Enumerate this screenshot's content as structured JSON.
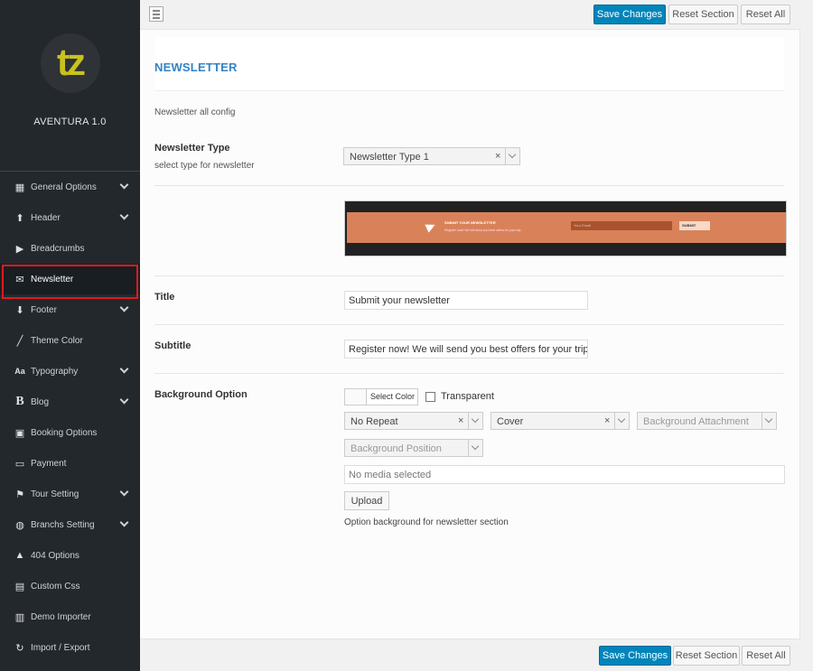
{
  "sidebar": {
    "brand_name": "AVENTURA 1.0",
    "logo_text": "tz",
    "items": [
      {
        "label": "General Options",
        "icon": "grid-icon",
        "has_children": true
      },
      {
        "label": "Header",
        "icon": "arrow-up-icon",
        "has_children": true
      },
      {
        "label": "Breadcrumbs",
        "icon": "play-icon",
        "has_children": false
      },
      {
        "label": "Newsletter",
        "icon": "envelope-icon",
        "has_children": false,
        "active": true
      },
      {
        "label": "Footer",
        "icon": "arrow-down-icon",
        "has_children": true
      },
      {
        "label": "Theme Color",
        "icon": "brush-icon",
        "has_children": false
      },
      {
        "label": "Typography",
        "icon": "font-icon",
        "has_children": true
      },
      {
        "label": "Blog",
        "icon": "bold-b-icon",
        "has_children": true
      },
      {
        "label": "Booking Options",
        "icon": "book-icon",
        "has_children": false
      },
      {
        "label": "Payment",
        "icon": "credit-card-icon",
        "has_children": false
      },
      {
        "label": "Tour Setting",
        "icon": "flag-icon",
        "has_children": true
      },
      {
        "label": "Branchs Setting",
        "icon": "globe-icon",
        "has_children": true
      },
      {
        "label": "404 Options",
        "icon": "warning-icon",
        "has_children": false
      },
      {
        "label": "Custom Css",
        "icon": "code-icon",
        "has_children": false
      },
      {
        "label": "Demo Importer",
        "icon": "monitor-icon",
        "has_children": false
      },
      {
        "label": "Import / Export",
        "icon": "refresh-icon",
        "has_children": false
      }
    ]
  },
  "toolbar": {
    "save_label": "Save Changes",
    "reset_section_label": "Reset Section",
    "reset_all_label": "Reset All"
  },
  "section": {
    "title": "NEWSLETTER",
    "description": "Newsletter all config"
  },
  "fields": {
    "newsletter_type": {
      "label": "Newsletter Type",
      "sublabel": "select type for newsletter",
      "value": "Newsletter Type 1"
    },
    "preview": {
      "heading": "SUBMIT YOUR NEWSLETTER",
      "subtext": "Register now! We will send you best offers for your trip.",
      "input_placeholder": "Your Email",
      "button_label": "SUBMIT"
    },
    "title": {
      "label": "Title",
      "value": "Submit your newsletter"
    },
    "subtitle": {
      "label": "Subtitle",
      "value": "Register now! We will send you best offers for your trip."
    },
    "background": {
      "label": "Background Option",
      "select_color_label": "Select Color",
      "transparent_label": "Transparent",
      "repeat_value": "No Repeat",
      "size_value": "Cover",
      "attachment_placeholder": "Background Attachment",
      "position_placeholder": "Background Position",
      "media_placeholder": "No media selected",
      "upload_label": "Upload",
      "description": "Option background for newsletter section"
    }
  },
  "colors": {
    "sidebar_bg": "#23282d",
    "primary_button": "#0085ba",
    "section_title": "#3582c4",
    "active_outline": "#e01b1b",
    "logo_yellow": "#c8c21c"
  }
}
